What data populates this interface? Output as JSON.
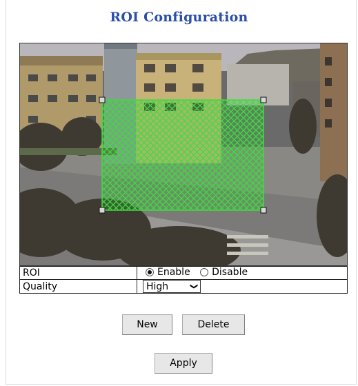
{
  "page": {
    "title": "ROI Configuration"
  },
  "roi": {
    "label": "ROI",
    "options": [
      {
        "label": "Enable",
        "checked": true
      },
      {
        "label": "Disable",
        "checked": false
      }
    ]
  },
  "quality": {
    "label": "Quality",
    "selected": "High"
  },
  "buttons": {
    "new": "New",
    "delete": "Delete",
    "apply": "Apply"
  },
  "colors": {
    "title": "#2a4fa8",
    "roi_overlay": "#38d038"
  }
}
